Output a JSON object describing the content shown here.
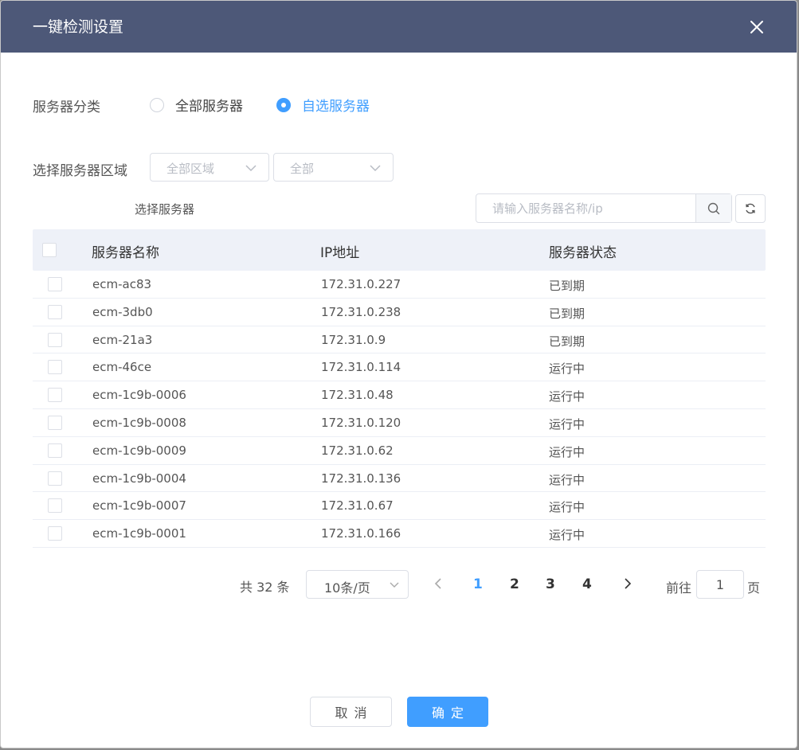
{
  "dialog": {
    "title": "一键检测设置",
    "close_icon": "close-icon"
  },
  "server_category": {
    "label": "服务器分类",
    "options": [
      {
        "label": "全部服务器",
        "checked": false
      },
      {
        "label": "自选服务器",
        "checked": true
      }
    ]
  },
  "region": {
    "label": "选择服务器区域",
    "region_select": "全部区域",
    "zone_select": "全部"
  },
  "select_servers_label": "选择服务器",
  "search": {
    "placeholder": "请输入服务器名称/ip",
    "icon": "search-icon",
    "refresh_icon": "refresh-icon"
  },
  "table": {
    "columns": [
      "服务器名称",
      "IP地址",
      "服务器状态"
    ],
    "rows": [
      {
        "name": "ecm-ac83",
        "ip": "172.31.0.227",
        "status": "已到期"
      },
      {
        "name": "ecm-3db0",
        "ip": "172.31.0.238",
        "status": "已到期"
      },
      {
        "name": "ecm-21a3",
        "ip": "172.31.0.9",
        "status": "已到期"
      },
      {
        "name": "ecm-46ce",
        "ip": "172.31.0.114",
        "status": "运行中"
      },
      {
        "name": "ecm-1c9b-0006",
        "ip": "172.31.0.48",
        "status": "运行中"
      },
      {
        "name": "ecm-1c9b-0008",
        "ip": "172.31.0.120",
        "status": "运行中"
      },
      {
        "name": "ecm-1c9b-0009",
        "ip": "172.31.0.62",
        "status": "运行中"
      },
      {
        "name": "ecm-1c9b-0004",
        "ip": "172.31.0.136",
        "status": "运行中"
      },
      {
        "name": "ecm-1c9b-0007",
        "ip": "172.31.0.67",
        "status": "运行中"
      },
      {
        "name": "ecm-1c9b-0001",
        "ip": "172.31.0.166",
        "status": "运行中"
      }
    ]
  },
  "pagination": {
    "total": "共 32 条",
    "page_size": "10条/页",
    "pages": [
      "1",
      "2",
      "3",
      "4"
    ],
    "current": "1",
    "goto_label": "前往",
    "goto_value": "1",
    "goto_suffix": "页"
  },
  "footer": {
    "cancel": "取消",
    "confirm": "确定"
  },
  "colors": {
    "header_bg": "#4d5878",
    "primary": "#409eff"
  }
}
